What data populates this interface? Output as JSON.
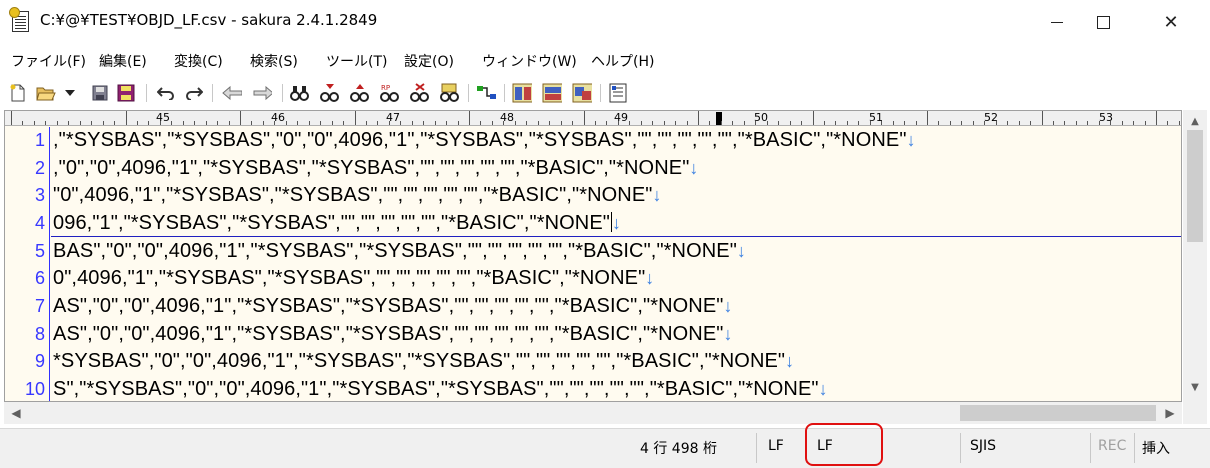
{
  "window": {
    "title": "C:¥@¥TEST¥OBJD_LF.csv - sakura 2.4.1.2849",
    "minimize": "",
    "maximize": "",
    "close": "✕"
  },
  "menu": [
    "ファイル(F)",
    "編集(E)",
    "変換(C)",
    "検索(S)",
    "ツール(T)",
    "設定(O)",
    "ウィンドウ(W)",
    "ヘルプ(H)"
  ],
  "ruler": {
    "labels": [
      "45",
      "46",
      "47",
      "48",
      "49",
      "50",
      "51",
      "52",
      "53"
    ]
  },
  "editor": {
    "lines": [
      {
        "no": "1",
        "text": ",\"*SYSBAS\",\"*SYSBAS\",\"0\",\"0\",4096,\"1\",\"*SYSBAS\",\"*SYSBAS\",\"\",\"\",\"\",\"\",\"\",\"*BASIC\",\"*NONE\"",
        "eol": "↓"
      },
      {
        "no": "2",
        "text": ",\"0\",\"0\",4096,\"1\",\"*SYSBAS\",\"*SYSBAS\",\"\",\"\",\"\",\"\",\"\",\"*BASIC\",\"*NONE\"",
        "eol": "↓"
      },
      {
        "no": "3",
        "text": "\"0\",4096,\"1\",\"*SYSBAS\",\"*SYSBAS\",\"\",\"\",\"\",\"\",\"\",\"*BASIC\",\"*NONE\"",
        "eol": "↓"
      },
      {
        "no": "4",
        "text": "096,\"1\",\"*SYSBAS\",\"*SYSBAS\",\"\",\"\",\"\",\"\",\"\",\"*BASIC\",\"*NONE\"",
        "eol": "↓"
      },
      {
        "no": "5",
        "text": "BAS\",\"0\",\"0\",4096,\"1\",\"*SYSBAS\",\"*SYSBAS\",\"\",\"\",\"\",\"\",\"\",\"*BASIC\",\"*NONE\"",
        "eol": "↓"
      },
      {
        "no": "6",
        "text": "0\",4096,\"1\",\"*SYSBAS\",\"*SYSBAS\",\"\",\"\",\"\",\"\",\"\",\"*BASIC\",\"*NONE\"",
        "eol": "↓"
      },
      {
        "no": "7",
        "text": "AS\",\"0\",\"0\",4096,\"1\",\"*SYSBAS\",\"*SYSBAS\",\"\",\"\",\"\",\"\",\"\",\"*BASIC\",\"*NONE\"",
        "eol": "↓"
      },
      {
        "no": "8",
        "text": "AS\",\"0\",\"0\",4096,\"1\",\"*SYSBAS\",\"*SYSBAS\",\"\",\"\",\"\",\"\",\"\",\"*BASIC\",\"*NONE\"",
        "eol": "↓"
      },
      {
        "no": "9",
        "text": "*SYSBAS\",\"0\",\"0\",4096,\"1\",\"*SYSBAS\",\"*SYSBAS\",\"\",\"\",\"\",\"\",\"\",\"*BASIC\",\"*NONE\"",
        "eol": "↓"
      },
      {
        "no": "10",
        "text": "S\",\"*SYSBAS\",\"0\",\"0\",4096,\"1\",\"*SYSBAS\",\"*SYSBAS\",\"\",\"\",\"\",\"\",\"\",\"*BASIC\",\"*NONE\"",
        "eol": "↓"
      }
    ]
  },
  "status": {
    "position": "4 行 498 桁",
    "eol_code": "LF",
    "eol_code_highlighted": "LF",
    "encoding": "SJIS",
    "rec": "REC",
    "insert_mode": "挿入"
  },
  "colors": {
    "editor_bg": "#fffbf0",
    "line_number": "#3838ff",
    "eol_mark": "#3a7fe0",
    "highlight": "#e01010"
  }
}
